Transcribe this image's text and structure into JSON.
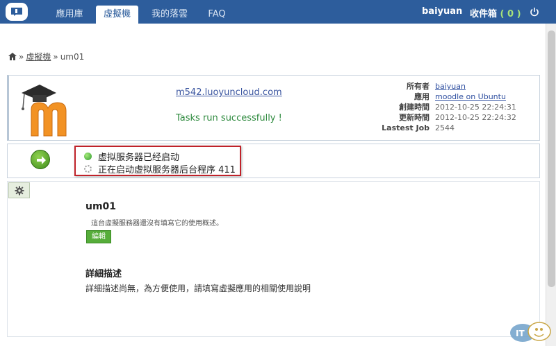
{
  "nav": {
    "tabs": [
      {
        "label": "應用庫"
      },
      {
        "label": "虛擬機"
      },
      {
        "label": "我的落雲"
      },
      {
        "label": "FAQ"
      }
    ],
    "active_tab": "虛擬機",
    "user": "baiyuan",
    "inbox_label": "收件箱",
    "inbox_open": "(",
    "inbox_count": "0",
    "inbox_close": ")",
    "icons": [
      "app-logo-icon",
      "power-icon"
    ]
  },
  "breadcrumb": {
    "items": [
      "虛擬機",
      "um01"
    ],
    "separator": "»"
  },
  "info": {
    "host": "m542.luoyuncloud.com",
    "task_message": "Tasks run successfully !",
    "meta": [
      {
        "label": "所有者",
        "value": "baiyuan"
      },
      {
        "label": "應用",
        "value": "moodle on Ubuntu"
      },
      {
        "label": "創建時間",
        "value": "2012-10-25 22:24:31"
      },
      {
        "label": "更新時間",
        "value": "2012-10-25 22:24:32"
      },
      {
        "label": "Lastest Job",
        "value": "2544"
      }
    ]
  },
  "status": {
    "lines": [
      "虚拟服务器已经启动",
      "正在启动虚拟服务器后台程序 411"
    ],
    "highlight_color": "#c0222a"
  },
  "detail": {
    "name": "um01",
    "description": "這台虛擬服務器還沒有填寫它的使用概述。",
    "edit_label": "編輯",
    "detail_title": "詳細描述",
    "detail_text": "詳細描述尚無，為方便使用，請填寫虛擬應用的相關使用說明"
  },
  "colors": {
    "nav_bg": "#2d5d9c",
    "success_text": "#2e8a3e",
    "edit_button": "#56ad3a"
  }
}
